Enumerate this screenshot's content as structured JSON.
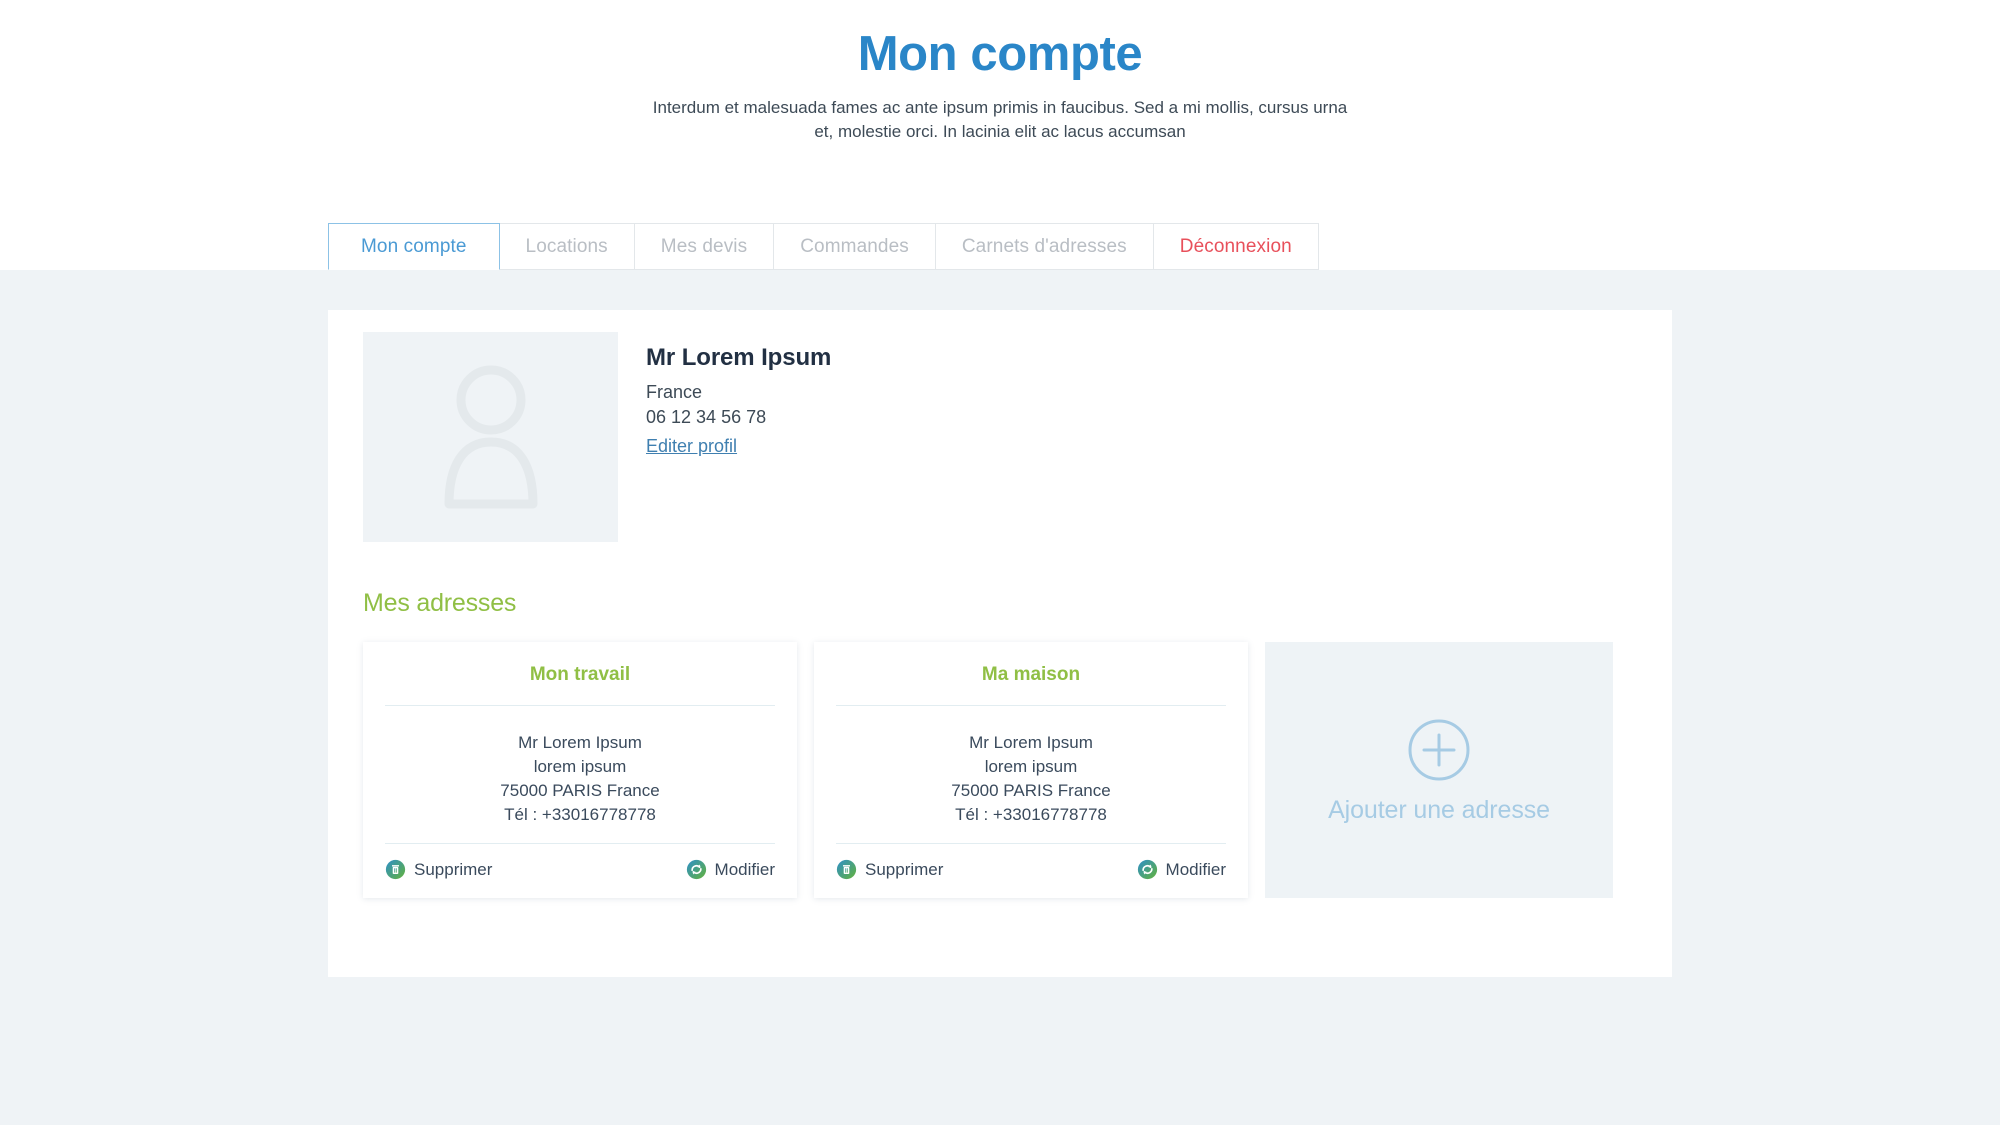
{
  "header": {
    "title": "Mon compte",
    "subtitle": "Interdum et malesuada fames ac ante ipsum primis in faucibus. Sed a mi mollis, cursus urna et, molestie orci. In lacinia elit ac lacus accumsan"
  },
  "colors": {
    "title_blue": "#2a86c8",
    "active_tab_blue": "#4a9ad4",
    "inactive_tab_grey": "#b9bec4",
    "logout_red": "#e8505b",
    "green": "#90bf45",
    "page_background": "#eff3f6",
    "panel_background": "#ffffff",
    "link_blue": "#3f7fb0",
    "add_card_blue": "#a6cbe4"
  },
  "tabs": [
    {
      "label": "Mon compte",
      "active": true,
      "style": "active"
    },
    {
      "label": "Locations",
      "active": false,
      "style": "inactive"
    },
    {
      "label": "Mes devis",
      "active": false,
      "style": "inactive"
    },
    {
      "label": "Commandes",
      "active": false,
      "style": "inactive"
    },
    {
      "label": "Carnets d'adresses",
      "active": false,
      "style": "inactive"
    },
    {
      "label": "Déconnexion",
      "active": false,
      "style": "danger"
    }
  ],
  "profile": {
    "avatar_icon": "user-silhouette-icon",
    "name": "Mr Lorem Ipsum",
    "country": "France",
    "phone": "06 12 34 56 78",
    "edit_link": "Editer profil"
  },
  "addresses_section": {
    "title": "Mes adresses",
    "cards": [
      {
        "title": "Mon travail",
        "lines": [
          "Mr Lorem Ipsum",
          "lorem ipsum",
          "75000 PARIS France",
          "Tél : +33016778778"
        ],
        "delete_label": "Supprimer",
        "delete_icon": "trash-icon",
        "edit_label": "Modifier",
        "edit_icon": "sync-refresh-icon"
      },
      {
        "title": "Ma maison",
        "lines": [
          "Mr Lorem Ipsum",
          "lorem ipsum",
          "75000 PARIS France",
          "Tél : +33016778778"
        ],
        "delete_label": "Supprimer",
        "delete_icon": "trash-icon",
        "edit_label": "Modifier",
        "edit_icon": "sync-refresh-icon"
      }
    ],
    "add_card": {
      "label": "Ajouter une adresse",
      "icon": "plus-circle-icon"
    }
  }
}
